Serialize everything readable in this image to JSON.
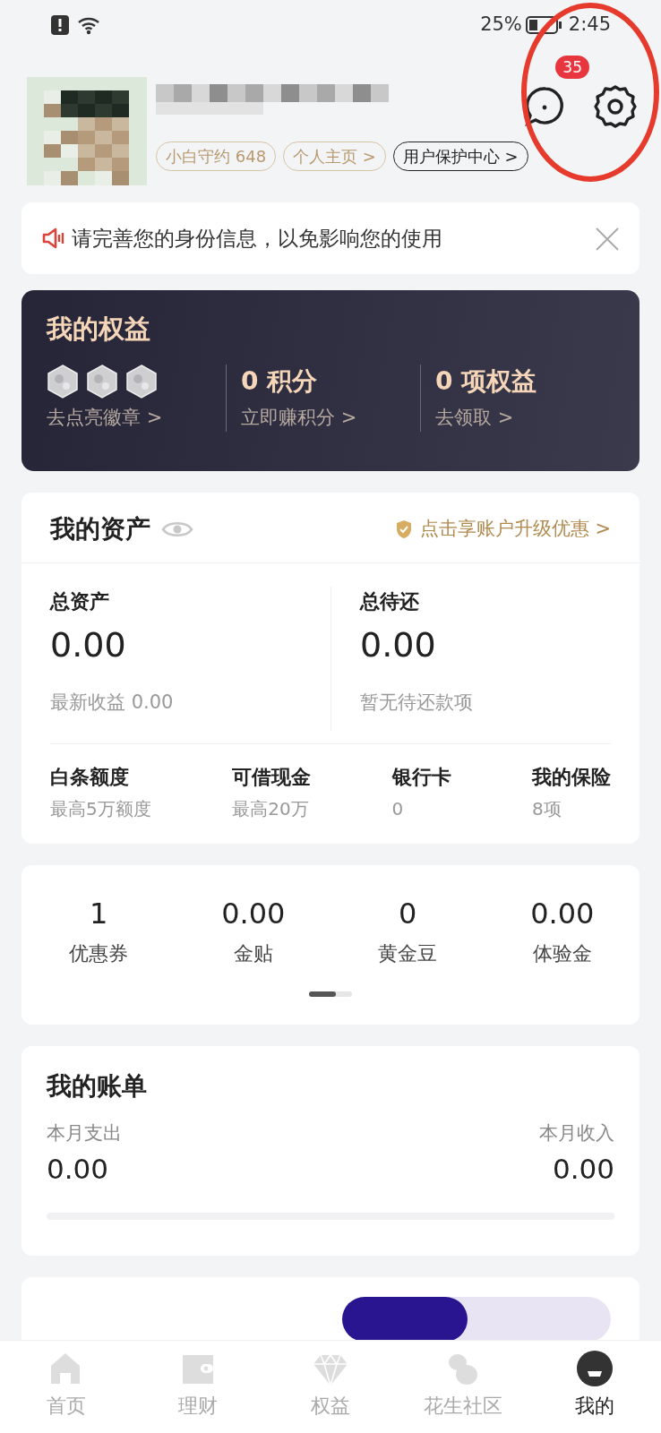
{
  "status_bar": {
    "battery": "25%",
    "time": "2:45"
  },
  "profile": {
    "message_count": "35",
    "tags": [
      {
        "label": "小白守约 648",
        "kind": "gold"
      },
      {
        "label": "个人主页 >",
        "kind": "gold"
      },
      {
        "label": "用户保护中心 >",
        "kind": "dark"
      }
    ]
  },
  "notice": {
    "text": "请完善您的身份信息，以免影响您的使用"
  },
  "benefits": {
    "title": "我的权益",
    "items": [
      {
        "value": "",
        "link": "去点亮徽章 >",
        "kind": "badges"
      },
      {
        "value": "0 积分",
        "link": "立即赚积分 >",
        "kind": "text"
      },
      {
        "value": "0 项权益",
        "link": "去领取 >",
        "kind": "text"
      }
    ]
  },
  "assets": {
    "title": "我的资产",
    "promo": "点击享账户升级优惠 >",
    "totals": [
      {
        "label": "总资产",
        "value": "0.00",
        "note": "最新收益 0.00"
      },
      {
        "label": "总待还",
        "value": "0.00",
        "note": "暂无待还款项"
      }
    ],
    "items": [
      {
        "label": "白条额度",
        "value": "最高5万额度"
      },
      {
        "label": "可借现金",
        "value": "最高20万"
      },
      {
        "label": "银行卡",
        "value": "0"
      },
      {
        "label": "我的保险",
        "value": "8项"
      }
    ]
  },
  "counts": [
    {
      "value": "1",
      "label": "优惠券"
    },
    {
      "value": "0.00",
      "label": "金贴"
    },
    {
      "value": "0",
      "label": "黄金豆"
    },
    {
      "value": "0.00",
      "label": "体验金"
    }
  ],
  "bill": {
    "title": "我的账单",
    "expense_label": "本月支出",
    "expense": "0.00",
    "income_label": "本月收入",
    "income": "0.00"
  },
  "tabbar": [
    {
      "label": "首页",
      "selected": false
    },
    {
      "label": "理财",
      "selected": false
    },
    {
      "label": "权益",
      "selected": false
    },
    {
      "label": "花生社区",
      "selected": false
    },
    {
      "label": "我的",
      "selected": true
    }
  ]
}
